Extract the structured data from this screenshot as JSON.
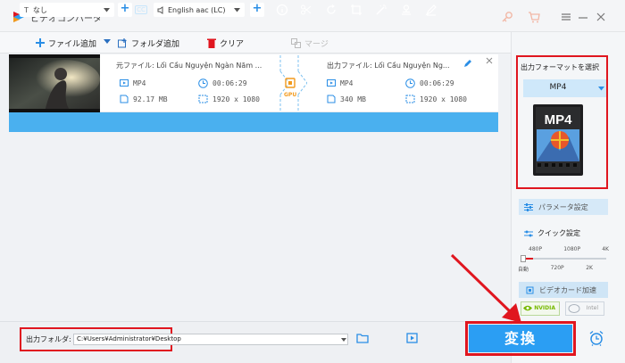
{
  "app": {
    "title": "ビデオコンバータ",
    "icons": [
      "key-icon",
      "cart-icon",
      "menu-icon",
      "minimize-icon",
      "close-icon"
    ]
  },
  "toolbar": {
    "add_file_label": "ファイル追加",
    "add_folder_label": "フォルダ追加",
    "clear_label": "クリア",
    "merge_label": "マージ"
  },
  "file": {
    "source_label": "元ファイル: Lối Cầu Nguyện Ngàn Năm ...",
    "source_format": "MP4",
    "source_duration": "00:06:29",
    "source_size": "92.17 MB",
    "source_resolution": "1920 x 1080",
    "gpu_label": "GPU",
    "output_label": "出力ファイル: Lối Cầu Nguyện Ng...",
    "output_format": "MP4",
    "output_duration": "00:06:29",
    "output_size": "340 MB",
    "output_resolution": "1920 x 1080"
  },
  "editbar": {
    "subtitle_value": "なし",
    "cc_label": "CC",
    "audio_value": "English aac (LC)"
  },
  "panel": {
    "format_title": "出力フォーマットを選択",
    "format_name": "MP4",
    "format_image_text": "MP4",
    "params_label": "パラメータ設定",
    "quick_label": "クイック設定",
    "quality_top": [
      "480P",
      "1080P",
      "4K"
    ],
    "quality_bottom": [
      "自動",
      "720P",
      "2K"
    ],
    "quality_level": 0,
    "gpu_accel_label": "ビデオカード加速",
    "nvidia_label": "NVIDIA",
    "intel_label": "Intel"
  },
  "bottom": {
    "folder_label": "出力フォルダ:",
    "folder_path": "C:¥Users¥Administrator¥Desktop",
    "convert_label": "変換"
  },
  "colors": {
    "accent": "#2b9ef3",
    "editbar": "#4ab0ef",
    "highlight": "#e0161f"
  }
}
